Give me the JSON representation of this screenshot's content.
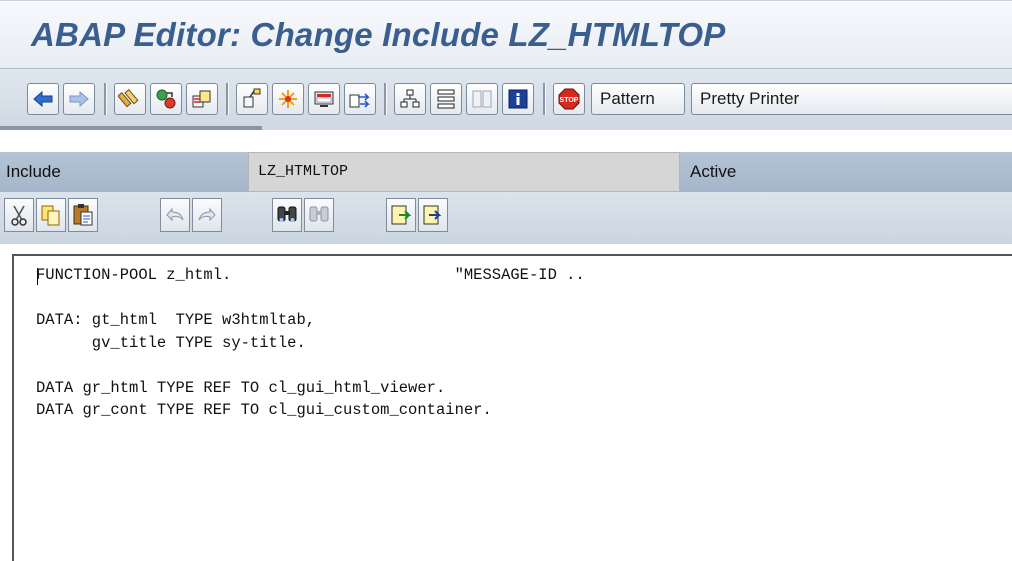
{
  "window": {
    "title": "ABAP Editor: Change Include LZ_HTMLTOP"
  },
  "app_toolbar": {
    "buttons": [
      {
        "icon": "back-arrow-icon"
      },
      {
        "icon": "forward-arrow-icon"
      },
      {
        "icon": "display-change-icon"
      },
      {
        "icon": "active-inactive-icon"
      },
      {
        "icon": "other-object-icon"
      },
      {
        "icon": "check-icon"
      },
      {
        "icon": "activate-icon"
      },
      {
        "icon": "test-icon"
      },
      {
        "icon": "where-used-icon"
      },
      {
        "icon": "object-list-icon"
      },
      {
        "icon": "display-navigation-icon"
      },
      {
        "icon": "fullscreen-icon"
      },
      {
        "icon": "info-icon"
      },
      {
        "icon": "stop-icon"
      }
    ],
    "pattern_label": "Pattern",
    "pretty_printer_label": "Pretty Printer"
  },
  "field_bar": {
    "include_label": "Include",
    "include_value": "LZ_HTMLTOP",
    "status": "Active"
  },
  "edit_toolbar": {
    "buttons": [
      {
        "icon": "cut-icon"
      },
      {
        "icon": "copy-icon"
      },
      {
        "icon": "paste-icon"
      },
      {
        "icon": "undo-icon"
      },
      {
        "icon": "redo-icon"
      },
      {
        "icon": "find-icon"
      },
      {
        "icon": "find-next-icon"
      },
      {
        "icon": "insert-line-icon"
      },
      {
        "icon": "append-line-icon"
      }
    ]
  },
  "editor": {
    "lines": [
      "FUNCTION-POOL z_html.                        \"MESSAGE-ID ..",
      "",
      "DATA: gt_html  TYPE w3htmltab,",
      "      gv_title TYPE sy-title.",
      "",
      "DATA gr_html TYPE REF TO cl_gui_html_viewer.",
      "DATA gr_cont TYPE REF TO cl_gui_custom_container."
    ]
  },
  "colors": {
    "title": "#3a5e8e",
    "toolbar_bg": "#dfe6ee",
    "field_band": "#b4c4d6",
    "field_value_bg": "#d6d6d6"
  }
}
